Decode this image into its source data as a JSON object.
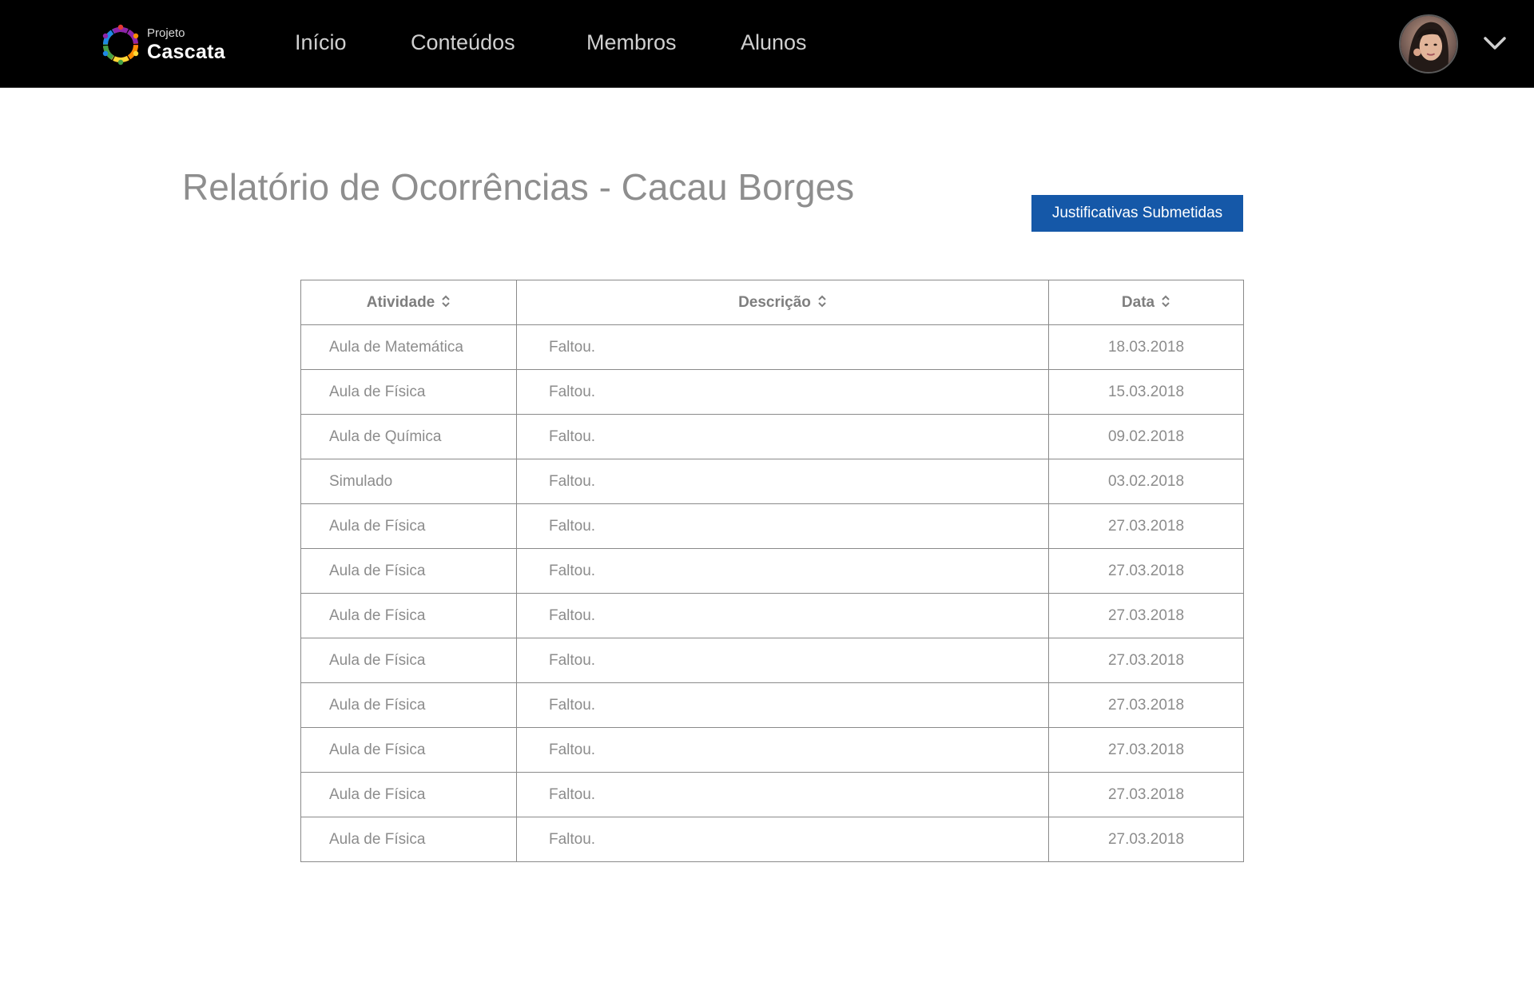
{
  "brand": {
    "small": "Projeto",
    "big": "Cascata",
    "logo_colors": [
      "#e53935",
      "#fb8c00",
      "#fdd835",
      "#43a047",
      "#1e88e5",
      "#8e24aa"
    ]
  },
  "nav": {
    "items": [
      {
        "label": "Início"
      },
      {
        "label": "Conteúdos"
      },
      {
        "label": "Membros"
      },
      {
        "label": "Alunos"
      }
    ]
  },
  "user": {
    "avatar_icon": "avatar-photo",
    "menu_icon": "chevron-down-icon"
  },
  "page": {
    "title": "Relatório de Ocorrências - Cacau Borges",
    "action_button": "Justificativas Submetidas",
    "accent_color": "#1558a8"
  },
  "table": {
    "columns": [
      {
        "label": "Atividade",
        "sort_icon": "sort-icon"
      },
      {
        "label": "Descrição",
        "sort_icon": "sort-icon"
      },
      {
        "label": "Data",
        "sort_icon": "sort-icon"
      }
    ],
    "rows": [
      {
        "atividade": "Aula de Matemática",
        "descricao": "Faltou.",
        "data": "18.03.2018"
      },
      {
        "atividade": "Aula de Física",
        "descricao": "Faltou.",
        "data": "15.03.2018"
      },
      {
        "atividade": "Aula de Química",
        "descricao": "Faltou.",
        "data": "09.02.2018"
      },
      {
        "atividade": "Simulado",
        "descricao": "Faltou.",
        "data": "03.02.2018"
      },
      {
        "atividade": "Aula de Física",
        "descricao": "Faltou.",
        "data": "27.03.2018"
      },
      {
        "atividade": "Aula de Física",
        "descricao": "Faltou.",
        "data": "27.03.2018"
      },
      {
        "atividade": "Aula de Física",
        "descricao": "Faltou.",
        "data": "27.03.2018"
      },
      {
        "atividade": "Aula de Física",
        "descricao": "Faltou.",
        "data": "27.03.2018"
      },
      {
        "atividade": "Aula de Física",
        "descricao": "Faltou.",
        "data": "27.03.2018"
      },
      {
        "atividade": "Aula de Física",
        "descricao": "Faltou.",
        "data": "27.03.2018"
      },
      {
        "atividade": "Aula de Física",
        "descricao": "Faltou.",
        "data": "27.03.2018"
      },
      {
        "atividade": "Aula de Física",
        "descricao": "Faltou.",
        "data": "27.03.2018"
      }
    ]
  }
}
